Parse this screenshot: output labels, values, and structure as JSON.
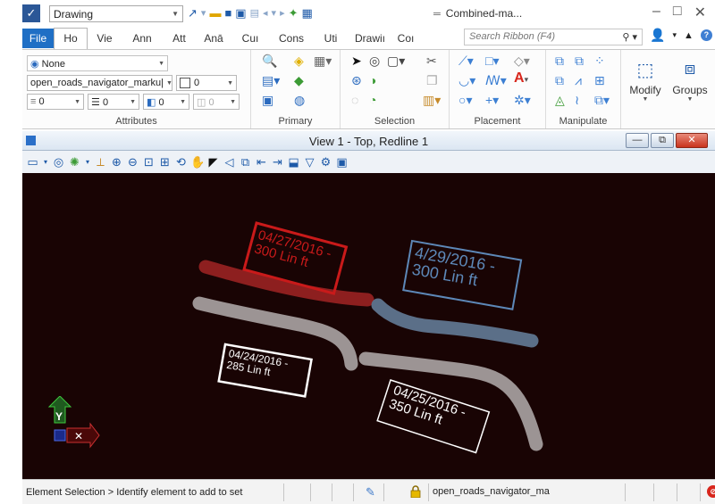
{
  "titlebar": {
    "workspace": "Drawing",
    "doc_title": "Combined-ma...",
    "qat_icons": [
      "element-selection-icon",
      "open-icon",
      "save-icon",
      "save-settings-icon",
      "compress-icon",
      "undo-icon",
      "redo-icon",
      "pin-icon",
      "print-icon"
    ]
  },
  "tabs": [
    {
      "label": "File"
    },
    {
      "label": "Ho"
    },
    {
      "label": "Vie"
    },
    {
      "label": "Ann"
    },
    {
      "label": "Att"
    },
    {
      "label": "Anā"
    },
    {
      "label": "Cuı"
    },
    {
      "label": "Cons"
    },
    {
      "label": "Uti"
    },
    {
      "label": "Drawiı"
    },
    {
      "label": "Coı"
    }
  ],
  "search": {
    "placeholder": "Search Ribbon (F4)"
  },
  "ribbon": {
    "attributes": {
      "label": "Attributes",
      "element_template": "None",
      "level": "open_roads_navigator_marku|",
      "color": "0",
      "line_style": "0",
      "line_weight": "0",
      "transparency": "0",
      "priority": "0"
    },
    "primary": {
      "label": "Primary"
    },
    "selection": {
      "label": "Selection"
    },
    "placement": {
      "label": "Placement"
    },
    "manipulate": {
      "label": "Manipulate"
    },
    "modify": {
      "label": "Modify"
    },
    "groups": {
      "label": "Groups"
    }
  },
  "view": {
    "title": "View 1 - Top, Redline 1",
    "background_color": "#190404"
  },
  "annotations": [
    {
      "text1": "04/27/2016 -",
      "text2": "300 Lin ft",
      "color": "#c91a1a"
    },
    {
      "text1": "4/29/2016 -",
      "text2": "300 Lin ft",
      "color": "#5d88b8"
    },
    {
      "text1": "04/24/2016 -",
      "text2": "285 Lin ft",
      "color": "#ffffff"
    },
    {
      "text1": "04/25/2016 -",
      "text2": "350 Lin ft",
      "color": "#ffffff"
    }
  ],
  "status": {
    "message": "Element Selection > Identify element to add to set",
    "active_model": "open_roads_navigator_ma"
  },
  "colors": {
    "accent": "#1f6fc5",
    "red_markup": "#8d1f1f",
    "blue_markup": "#5b6f88",
    "gray_markup": "#9c9494"
  }
}
